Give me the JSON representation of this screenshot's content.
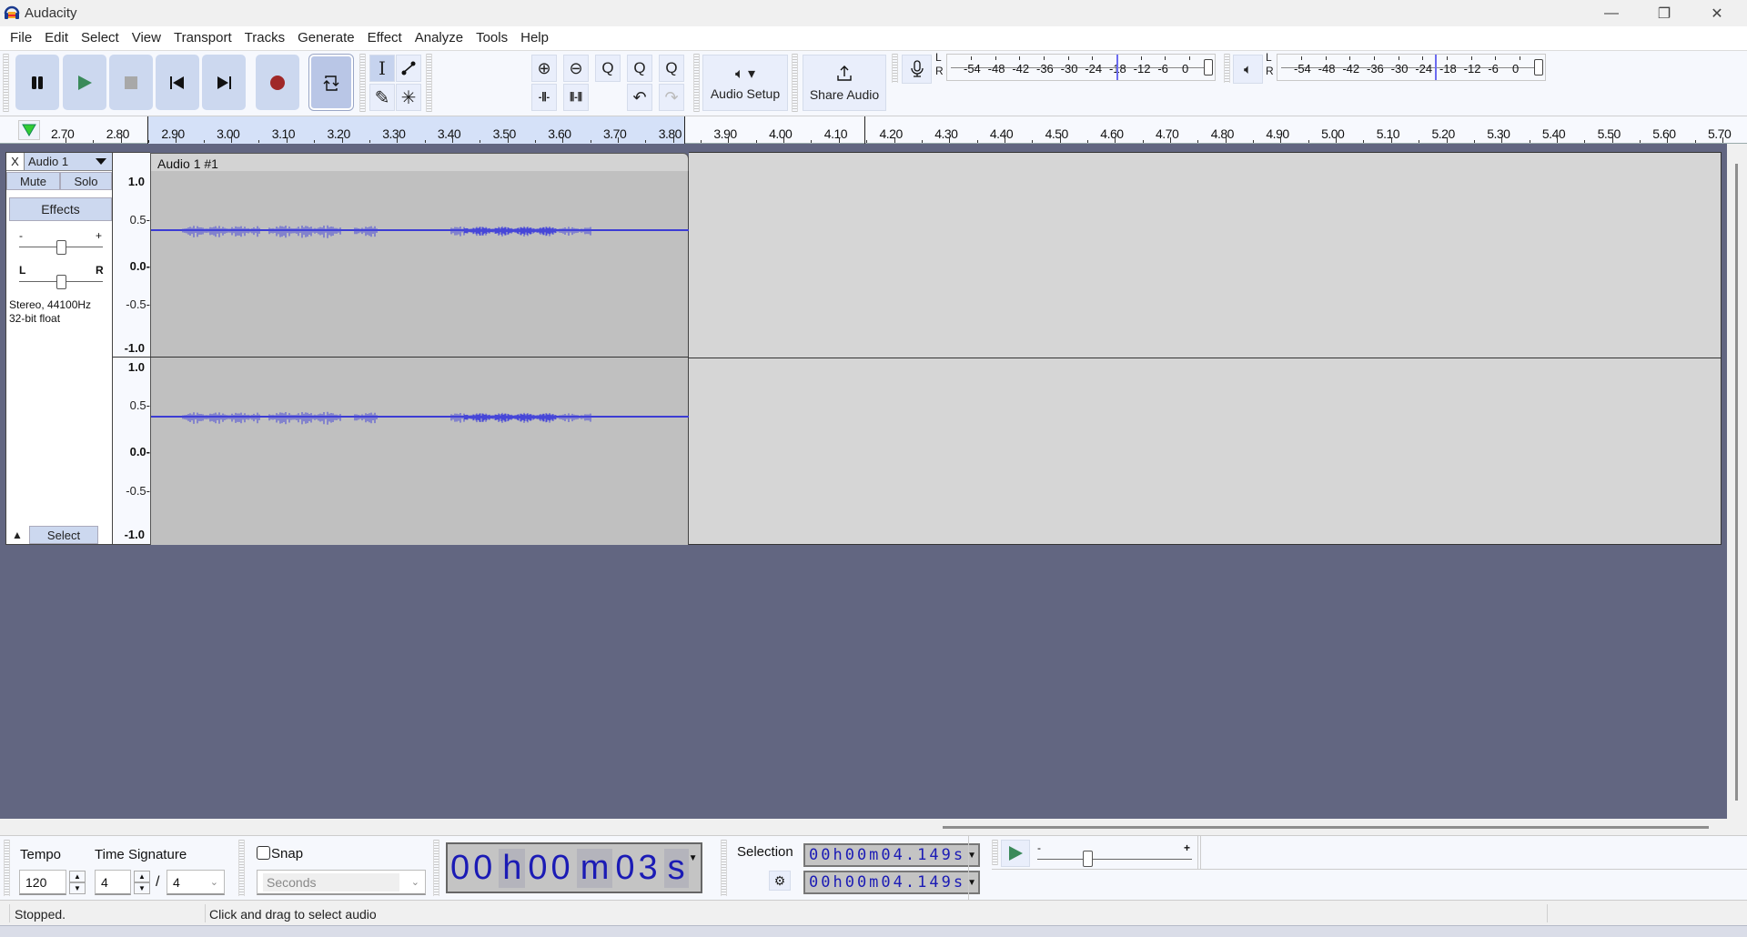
{
  "window": {
    "title": "Audacity",
    "controls": {
      "minimize": "—",
      "maximize": "❐",
      "close": "✕"
    }
  },
  "menu": [
    "File",
    "Edit",
    "Select",
    "View",
    "Transport",
    "Tracks",
    "Generate",
    "Effect",
    "Analyze",
    "Tools",
    "Help"
  ],
  "transport": {
    "buttons": [
      {
        "name": "pause",
        "icon": "pause-icon"
      },
      {
        "name": "play",
        "icon": "play-icon"
      },
      {
        "name": "stop",
        "icon": "stop-icon"
      },
      {
        "name": "skip-to-start",
        "icon": "skip-start-icon"
      },
      {
        "name": "skip-to-end",
        "icon": "skip-end-icon"
      },
      {
        "name": "record",
        "icon": "record-icon"
      },
      {
        "name": "loop",
        "icon": "loop-icon"
      }
    ]
  },
  "tools": {
    "selection": "I",
    "envelope": "⟋",
    "draw": "✎",
    "multi": "✳"
  },
  "edit_tools": {
    "zoom_in": "⊕",
    "zoom_out": "⊖",
    "fit_selection": "Q",
    "fit_project": "Q",
    "zoom_toggle": "Q",
    "trim": "-⫼-",
    "silence": "⫼-⫼",
    "undo": "↶",
    "redo": "↷"
  },
  "audio_setup": {
    "label": "Audio Setup",
    "icon": "🔈"
  },
  "share_audio": {
    "label": "Share Audio",
    "icon": "⇧"
  },
  "meters": {
    "record": {
      "L": "L",
      "R": "R",
      "scale": [
        "-54",
        "-48",
        "-42",
        "-36",
        "-30",
        "-24",
        "-18",
        "-12",
        "-6",
        "0"
      ],
      "level_marker_db": -18
    },
    "playback": {
      "L": "L",
      "R": "R",
      "scale": [
        "-54",
        "-48",
        "-42",
        "-36",
        "-30",
        "-24",
        "-18",
        "-12",
        "-6",
        "0"
      ],
      "level_marker_db": -21
    }
  },
  "ruler": {
    "ticks": [
      "2.70",
      "2.80",
      "2.90",
      "3.00",
      "3.10",
      "3.20",
      "3.30",
      "3.40",
      "3.50",
      "3.60",
      "3.70",
      "3.80",
      "3.90",
      "4.00",
      "4.10",
      "4.20",
      "4.30",
      "4.40",
      "4.50",
      "4.60",
      "4.70",
      "4.80",
      "4.90",
      "5.00",
      "5.10",
      "5.20",
      "5.30",
      "5.40",
      "5.50",
      "5.60",
      "5.70"
    ],
    "selection_start": 2.85,
    "selection_end": 3.8
  },
  "track": {
    "name": "Audio 1",
    "close": "X",
    "mute": "Mute",
    "solo": "Solo",
    "effects": "Effects",
    "gain_minus": "-",
    "gain_plus": "+",
    "pan_left": "L",
    "pan_right": "R",
    "info_line1": "Stereo, 44100Hz",
    "info_line2": "32-bit float",
    "select": "Select",
    "collapse": "▲",
    "clip_name": "Audio 1 #1",
    "vruler": [
      "1.0",
      "0.5-",
      "0.0-",
      "-0.5-",
      "-1.0"
    ]
  },
  "time_signature": {
    "tempo_label": "Tempo",
    "tempo": "120",
    "ts_label": "Time Signature",
    "numerator": "4",
    "slash": "/",
    "denominator": "4"
  },
  "snap": {
    "label": "Snap",
    "checked": false,
    "unit": "Seconds"
  },
  "time_display": {
    "hh": "00",
    "h": "h",
    "mm": "00",
    "m": "m",
    "ss": "03",
    "s": "s"
  },
  "selection": {
    "label": "Selection",
    "start": "00h00m04.149s",
    "end": "00h00m04.149s"
  },
  "play_at_speed": {
    "minus": "-",
    "plus": "+"
  },
  "status": {
    "state": "Stopped.",
    "hint": "Click and drag to select audio"
  }
}
